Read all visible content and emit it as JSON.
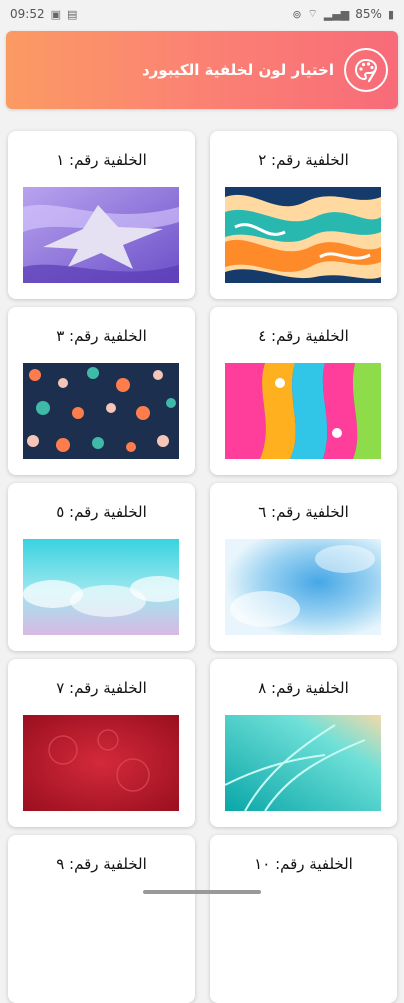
{
  "status_bar": {
    "time": "09:52",
    "battery": "85%"
  },
  "header": {
    "title": "اختيار لون لخلفية الكيبورد",
    "icon": "palette-icon"
  },
  "wallpapers": [
    {
      "label": "الخلفية رقم: ١"
    },
    {
      "label": "الخلفية رقم: ٢"
    },
    {
      "label": "الخلفية رقم: ٣"
    },
    {
      "label": "الخلفية رقم: ٤"
    },
    {
      "label": "الخلفية رقم: ٥"
    },
    {
      "label": "الخلفية رقم: ٦"
    },
    {
      "label": "الخلفية رقم: ٧"
    },
    {
      "label": "الخلفية رقم: ٨"
    },
    {
      "label": "الخلفية رقم: ٩"
    },
    {
      "label": "الخلفية رقم: ١٠"
    }
  ]
}
